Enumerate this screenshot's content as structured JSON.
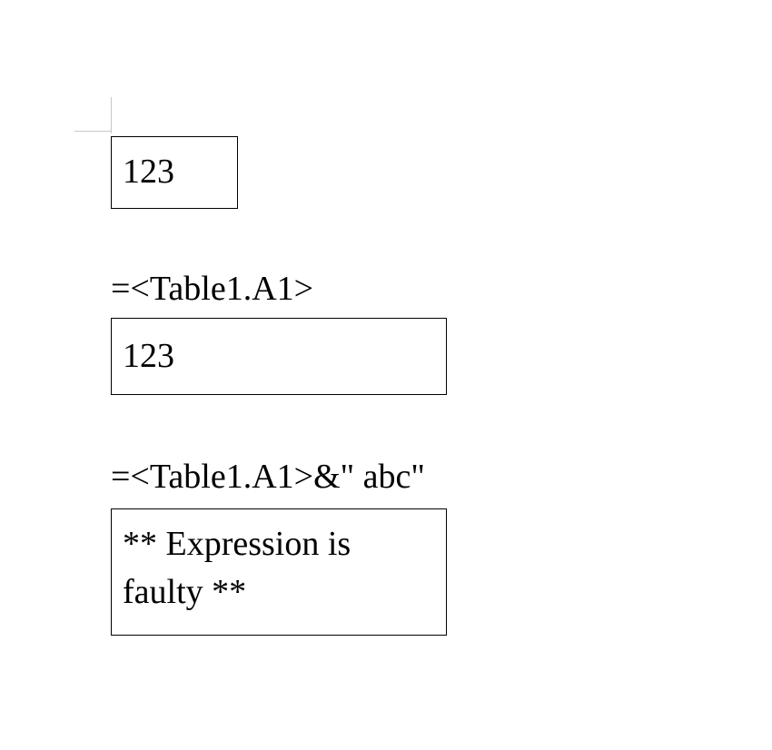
{
  "source_cell": {
    "value": "123"
  },
  "example1": {
    "formula": "=<Table1.A1>",
    "result": "123"
  },
  "example2": {
    "formula": "=<Table1.A1>&\" abc\"",
    "result": "** Expression is faulty **"
  }
}
